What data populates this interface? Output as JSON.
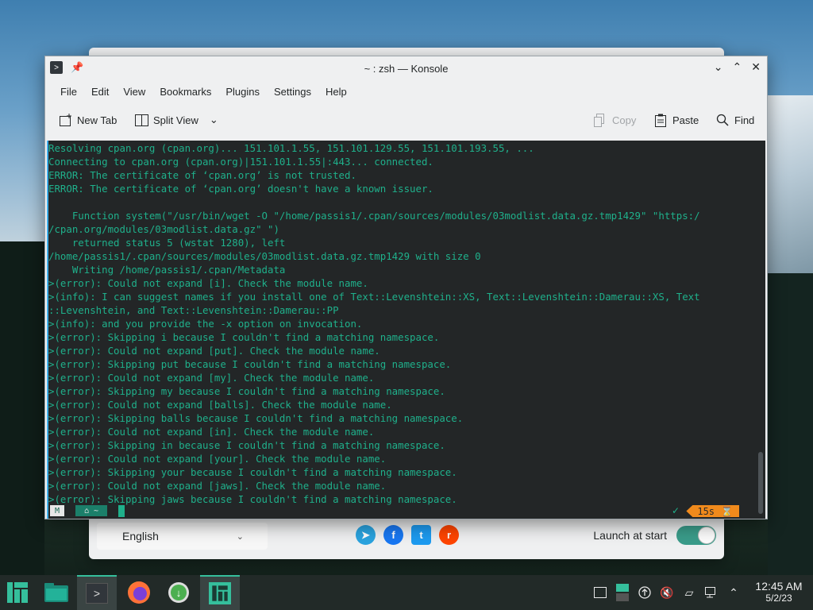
{
  "window": {
    "title": "~ : zsh — Konsole"
  },
  "menu": [
    "File",
    "Edit",
    "View",
    "Bookmarks",
    "Plugins",
    "Settings",
    "Help"
  ],
  "toolbar": {
    "new_tab": "New Tab",
    "split_view": "Split View",
    "copy": "Copy",
    "paste": "Paste",
    "find": "Find"
  },
  "terminal": {
    "lines": [
      "Resolving cpan.org (cpan.org)... 151.101.1.55, 151.101.129.55, 151.101.193.55, ...",
      "Connecting to cpan.org (cpan.org)|151.101.1.55|:443... connected.",
      "ERROR: The certificate of ‘cpan.org’ is not trusted.",
      "ERROR: The certificate of ‘cpan.org’ doesn't have a known issuer.",
      "",
      "    Function system(\"/usr/bin/wget -O \"/home/passis1/.cpan/sources/modules/03modlist.data.gz.tmp1429\" \"https:/",
      "/cpan.org/modules/03modlist.data.gz\" \")",
      "    returned status 5 (wstat 1280), left",
      "/home/passis1/.cpan/sources/modules/03modlist.data.gz.tmp1429 with size 0",
      "    Writing /home/passis1/.cpan/Metadata",
      ">(error): Could not expand [i]. Check the module name.",
      ">(info): I can suggest names if you install one of Text::Levenshtein::XS, Text::Levenshtein::Damerau::XS, Text",
      "::Levenshtein, and Text::Levenshtein::Damerau::PP",
      ">(info): and you provide the -x option on invocation.",
      ">(error): Skipping i because I couldn't find a matching namespace.",
      ">(error): Could not expand [put]. Check the module name.",
      ">(error): Skipping put because I couldn't find a matching namespace.",
      ">(error): Could not expand [my]. Check the module name.",
      ">(error): Skipping my because I couldn't find a matching namespace.",
      ">(error): Could not expand [balls]. Check the module name.",
      ">(error): Skipping balls because I couldn't find a matching namespace.",
      ">(error): Could not expand [in]. Check the module name.",
      ">(error): Skipping in because I couldn't find a matching namespace.",
      ">(error): Could not expand [your]. Check the module name.",
      ">(error): Skipping your because I couldn't find a matching namespace.",
      ">(error): Could not expand [jaws]. Check the module name.",
      ">(error): Skipping jaws because I couldn't find a matching namespace."
    ],
    "prompt_home": "~",
    "timer": "15s"
  },
  "welcome": {
    "language": "English",
    "launch_label": "Launch at start"
  },
  "clock": {
    "time": "12:45 AM",
    "date": "5/2/23"
  },
  "colors": {
    "terminal_bg": "#232627",
    "terminal_fg": "#1fb08b",
    "accent": "#35bf9c",
    "timer_bg": "#f08a1c"
  }
}
